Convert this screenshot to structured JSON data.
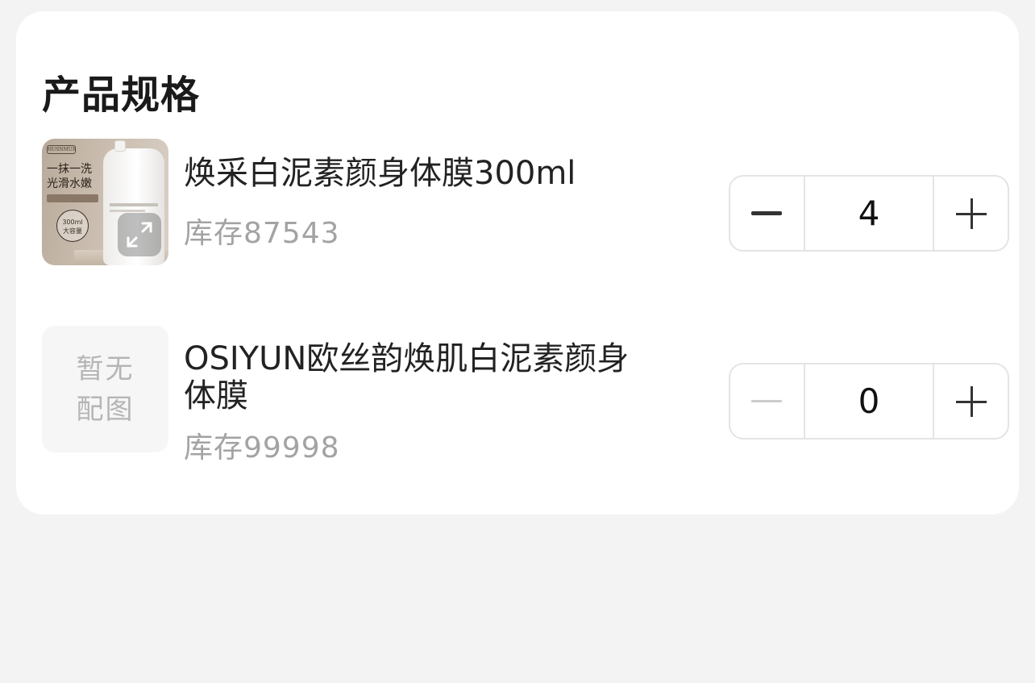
{
  "section_title": "产品规格",
  "products": [
    {
      "name": "焕采白泥素颜身体膜300ml",
      "stock": "库存87543",
      "quantity": "4",
      "image": {
        "type": "product-photo",
        "brand_text": "HUSNMUR",
        "slogan_line1": "一抹一洗",
        "slogan_line2": "光滑水嫩",
        "seal_line1": "300ml",
        "seal_line2": "大容量"
      },
      "minus_enabled": true
    },
    {
      "name": "OSIYUN欧丝韵焕肌白泥素颜身体膜",
      "stock": "库存99998",
      "quantity": "0",
      "image": {
        "type": "placeholder",
        "line1": "暂无",
        "line2": "配图"
      },
      "minus_enabled": false
    }
  ],
  "colors": {
    "page_bg": "#f3f3f3",
    "card_bg": "#ffffff",
    "stock_text": "#a3a3a3",
    "stepper_border": "#e4e4e4",
    "minus_active": "#333333",
    "minus_disabled": "#cccccc"
  },
  "icons": {
    "minus": "minus-icon",
    "plus": "plus-icon",
    "expand": "expand-icon"
  }
}
